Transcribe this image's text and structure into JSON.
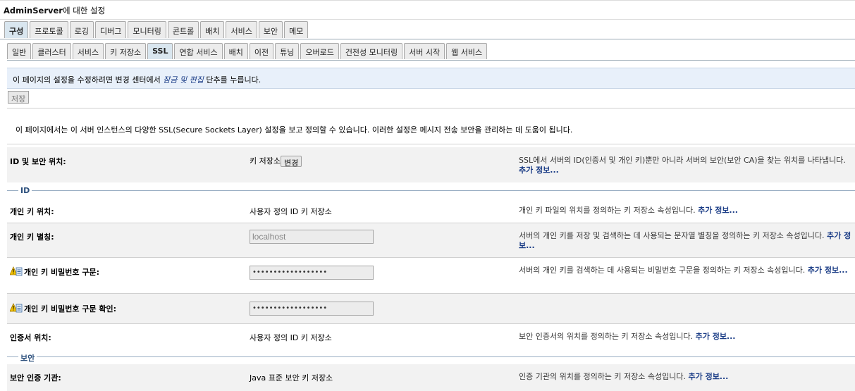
{
  "window": {
    "title_bold": "AdminServer",
    "title_rest": "에 대한 설정"
  },
  "tabs_primary": [
    "구성",
    "프로토콜",
    "로깅",
    "디버그",
    "모니터링",
    "콘트롤",
    "배치",
    "서비스",
    "보안",
    "메모"
  ],
  "tabs_secondary": [
    "일반",
    "클러스터",
    "서비스",
    "키 저장소",
    "SSL",
    "연합 서비스",
    "배치",
    "이전",
    "튜닝",
    "오버로드",
    "건전성 모니터링",
    "서버 시작",
    "웹 서비스"
  ],
  "info": {
    "prefix": "이 페이지의 설정을 수정하려면 변경 센터에서 ",
    "emph": "잠금 및 편집",
    "suffix": " 단추를 누릅니다."
  },
  "save_label": "저장",
  "description": "이 페이지에서는 이 서버 인스턴스의 다양한 SSL(Secure Sockets Layer) 설정을 보고 정의할 수 있습니다. 이러한 설정은 메시지 전송 보안을 관리하는 데 도움이 됩니다.",
  "identity": {
    "label": "ID 및 보안 위치:",
    "value": "키 저장소",
    "change_button": "변경",
    "help": "SSL에서 서버의 ID(인증서 및 개인 키)뿐만 아니라 서버의 보안(보안 CA)을 찾는 위치를 나타냅니다.",
    "more": "추가 정보..."
  },
  "section_id": "ID",
  "section_trust": "보안",
  "fields": {
    "pk_location": {
      "label": "개인 키 위치:",
      "value": "사용자 정의 ID 키 저장소",
      "help": "개인 키 파일의 위치를 정의하는 키 저장소 속성입니다.",
      "more": "추가 정보..."
    },
    "pk_alias": {
      "label": "개인 키 별칭:",
      "value": "localhost",
      "help": "서버의 개인 키를 저장 및 검색하는 데 사용되는 문자열 별칭을 정의하는 키 저장소 속성입니다.",
      "more": "추가 정보..."
    },
    "pk_pass": {
      "label": "개인 키 비밀번호 구문:",
      "value": "••••••••••••••••••",
      "help": "서버의 개인 키를 검색하는 데 사용되는 비밀번호 구문을 정의하는 키 저장소 속성입니다.",
      "more": "추가 정보..."
    },
    "pk_pass_confirm": {
      "label": "개인 키 비밀번호 구문 확인:",
      "value": "••••••••••••••••••"
    },
    "cert_location": {
      "label": "인증서 위치:",
      "value": "사용자 정의 ID 키 저장소",
      "help": "보안 인증서의 위치를 정의하는 키 저장소 속성입니다.",
      "more": "추가 정보..."
    },
    "trusted_ca": {
      "label": "보안 인증 기관:",
      "value": "Java 표준 보안 키 저장소",
      "help": "인증 기관의 위치를 정의하는 키 저장소 속성입니다.",
      "more": "추가 정보..."
    }
  },
  "icons": {
    "restart_required": "restart-required-icon"
  },
  "colors": {
    "tab_active": "#d9e6ef",
    "info_bg": "#e8f0fa",
    "link": "#1a3c86",
    "section_line": "#9aaec4"
  }
}
